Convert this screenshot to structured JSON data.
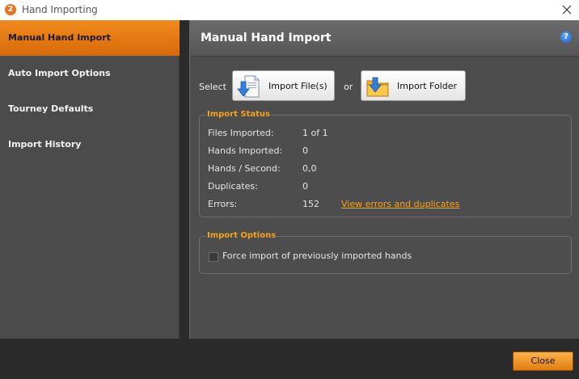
{
  "window": {
    "title": "Hand Importing",
    "app_icon_text": "2"
  },
  "sidebar": {
    "items": [
      {
        "label": "Manual Hand Import",
        "active": true
      },
      {
        "label": "Auto Import Options",
        "active": false
      },
      {
        "label": "Tourney Defaults",
        "active": false
      },
      {
        "label": "Import History",
        "active": false
      }
    ]
  },
  "main": {
    "title": "Manual Hand Import",
    "help_icon_text": "?",
    "select_label": "Select",
    "or_label": "or",
    "import_file_button": "Import File(s)",
    "import_folder_button": "Import Folder"
  },
  "import_status": {
    "legend": "Import Status",
    "rows": [
      {
        "label": "Files Imported:",
        "value": "1 of 1"
      },
      {
        "label": "Hands Imported:",
        "value": "0"
      },
      {
        "label": "Hands / Second:",
        "value": "0,0"
      },
      {
        "label": "Duplicates:",
        "value": "0"
      },
      {
        "label": "Errors:",
        "value": "152"
      }
    ],
    "errors_link": "View errors and duplicates"
  },
  "import_options": {
    "legend": "Import Options",
    "force_import_label": "Force import of previously imported hands",
    "force_import_checked": false
  },
  "footer": {
    "close_button": "Close"
  },
  "colors": {
    "accent": "#f08a1c",
    "legend_text": "#f6a21a",
    "panel_bg": "#4d4d4d",
    "sidebar_bg": "#4b4b4b",
    "window_bg": "#2b2b2b"
  }
}
